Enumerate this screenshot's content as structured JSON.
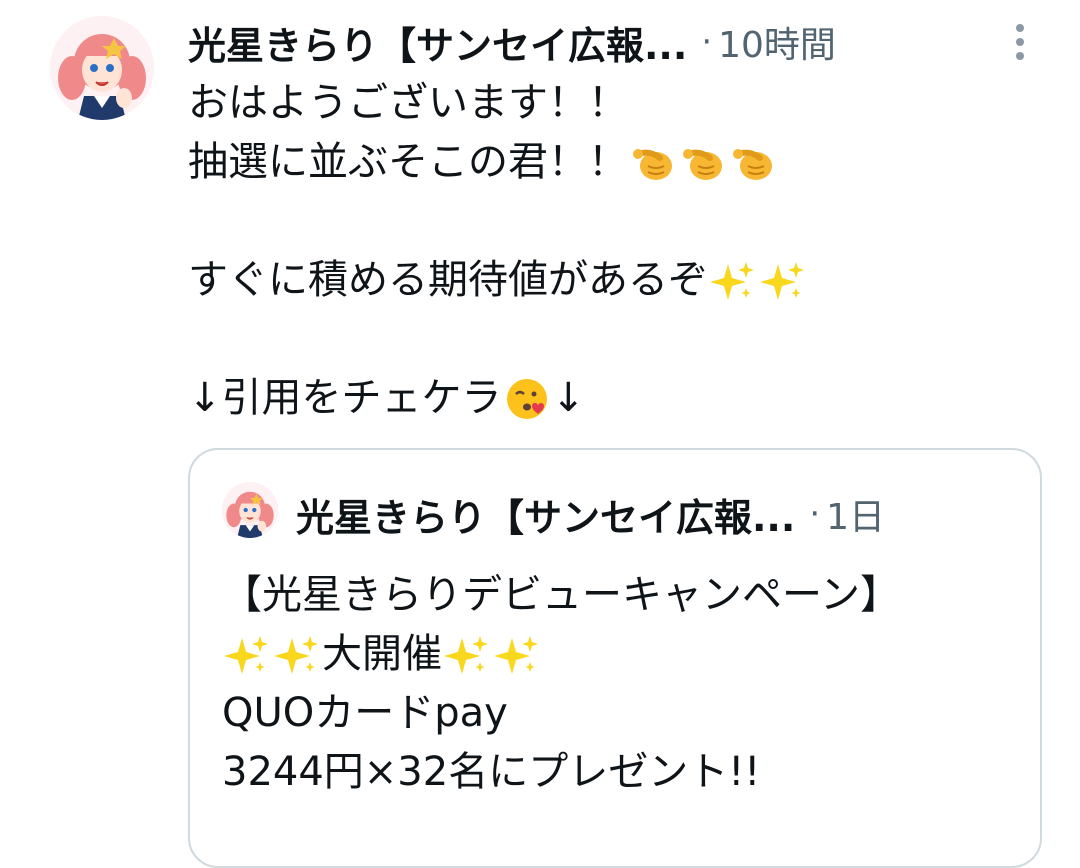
{
  "tweet": {
    "author_name": "光星きらり【サンセイ広報...",
    "separator": "·",
    "time": "10時間",
    "lines": [
      "おはようございます！！",
      "抽選に並ぶそこの君！！",
      "",
      "すぐに積める期待値があるぞ",
      "",
      "↓引用をチェケラ",
      "↓"
    ],
    "icons": [
      "pointing-hand-icon",
      "sparkles-icon",
      "kissing-face-icon",
      "more-vertical-icon"
    ]
  },
  "quote": {
    "author_name": "光星きらり【サンセイ広報...",
    "separator": "·",
    "time": "1日",
    "lines": [
      "【光星きらりデビューキャンペーン】",
      "大開催",
      "QUOカードpay",
      "3244円×32名にプレゼント!!"
    ]
  },
  "colors": {
    "text": "#0f1419",
    "secondary": "#536471",
    "border": "#cfd9de"
  }
}
